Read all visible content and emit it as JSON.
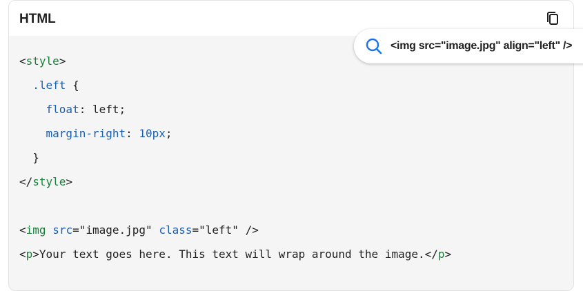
{
  "code_block": {
    "language_label": "HTML",
    "copy_icon": "copy-icon",
    "lines": [
      [
        {
          "t": "<",
          "c": "v"
        },
        {
          "t": "style",
          "c": "tag"
        },
        {
          "t": ">",
          "c": "v"
        }
      ],
      [
        {
          "t": "  ",
          "c": "v"
        },
        {
          "t": ".left",
          "c": "sel"
        },
        {
          "t": " {",
          "c": "v"
        }
      ],
      [
        {
          "t": "    ",
          "c": "v"
        },
        {
          "t": "float",
          "c": "attr"
        },
        {
          "t": ": left;",
          "c": "v"
        }
      ],
      [
        {
          "t": "    ",
          "c": "v"
        },
        {
          "t": "margin-right",
          "c": "attr"
        },
        {
          "t": ": ",
          "c": "v"
        },
        {
          "t": "10px",
          "c": "num"
        },
        {
          "t": ";",
          "c": "v"
        }
      ],
      [
        {
          "t": "  }",
          "c": "v"
        }
      ],
      [
        {
          "t": "</",
          "c": "v"
        },
        {
          "t": "style",
          "c": "tag"
        },
        {
          "t": ">",
          "c": "v"
        }
      ],
      [],
      [
        {
          "t": "<",
          "c": "v"
        },
        {
          "t": "img",
          "c": "tag"
        },
        {
          "t": " ",
          "c": "v"
        },
        {
          "t": "src",
          "c": "attr"
        },
        {
          "t": "=\"image.jpg\" ",
          "c": "v"
        },
        {
          "t": "class",
          "c": "attr"
        },
        {
          "t": "=\"left\" />",
          "c": "v"
        }
      ],
      [
        {
          "t": "<",
          "c": "v"
        },
        {
          "t": "p",
          "c": "tag"
        },
        {
          "t": ">Your text goes here. This text will wrap around the image.</",
          "c": "v"
        },
        {
          "t": "p",
          "c": "tag"
        },
        {
          "t": ">",
          "c": "v"
        }
      ]
    ]
  },
  "search_chip": {
    "icon": "search-icon",
    "query": "<img src=\"image.jpg\" align=\"left\" />"
  },
  "colors": {
    "tag": "#188038",
    "attr": "#1a5fb4",
    "text": "#1f1f1f",
    "search_icon": "#1a73e8"
  }
}
